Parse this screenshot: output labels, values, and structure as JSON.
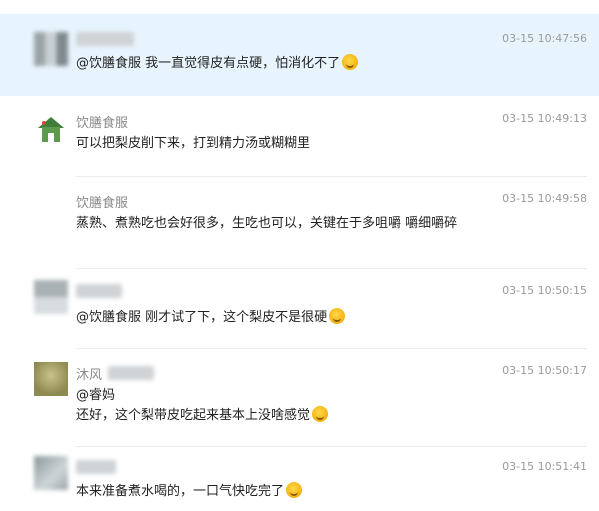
{
  "messages": [
    {
      "name": "",
      "time": "03-15 10:47:56",
      "text": "@饮膳食服 我一直觉得皮有点硬，怕消化不了",
      "emoji": "sweat-smile-emoji"
    },
    {
      "name": "饮膳食服",
      "time": "03-15 10:49:13",
      "text": "可以把梨皮削下来，打到精力汤或糊糊里"
    },
    {
      "name": "饮膳食服",
      "time": "03-15 10:49:58",
      "text": "蒸熟、煮熟吃也会好很多，生吃也可以，关键在于多咀嚼 嚼细嚼碎"
    },
    {
      "name": "",
      "time": "03-15 10:50:15",
      "text": "@饮膳食服 刚才试了下，这个梨皮不是很硬",
      "emoji": "thinking-emoji"
    },
    {
      "name": "沐风",
      "time": "03-15 10:50:17",
      "text_line1": "@睿妈",
      "text_line2": "还好，这个梨带皮吃起来基本上没啥感觉",
      "emoji": "grin-emoji"
    },
    {
      "name": "",
      "time": "03-15 10:51:41",
      "text": "本来准备煮水喝的，一口气快吃完了",
      "emoji": "sweat-smile-emoji"
    }
  ]
}
